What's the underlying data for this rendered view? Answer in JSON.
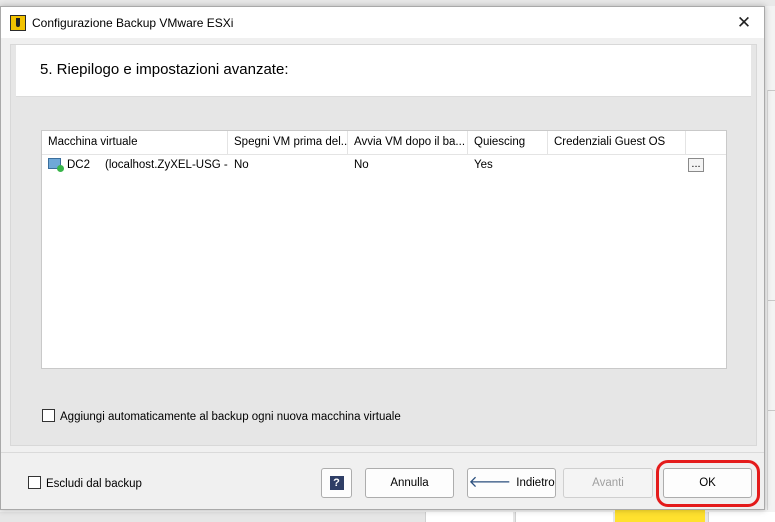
{
  "window": {
    "title": "Configurazione Backup VMware ESXi",
    "close_glyph": "✕"
  },
  "step": {
    "title": "5. Riepilogo e impostazioni avanzate:"
  },
  "grid": {
    "columns": [
      "Macchina virtuale",
      "Spegni VM prima del...",
      "Avvia VM dopo il ba...",
      "Quiescing",
      "Credenziali Guest OS"
    ],
    "rows": [
      {
        "vm_name": "DC2",
        "vm_host": "(localhost.ZyXEL-USG -...",
        "shutdown": "No",
        "start_after": "No",
        "quiescing": "Yes",
        "credentials": "",
        "button": "..."
      }
    ]
  },
  "options": {
    "auto_add_label": "Aggiungi automaticamente al backup ogni nuova macchina virtuale",
    "exclude_label": "Escludi dal backup"
  },
  "buttons": {
    "help": "?",
    "cancel": "Annulla",
    "back": "Indietro",
    "back_arrow": "🡐",
    "next": "Avanti",
    "ok": "OK"
  },
  "colors": {
    "highlight": "#e41b1b",
    "app_icon": "#f2c200"
  },
  "icons": [
    "app-icon",
    "close-icon",
    "vm-icon",
    "help-icon",
    "back-arrow-icon"
  ]
}
